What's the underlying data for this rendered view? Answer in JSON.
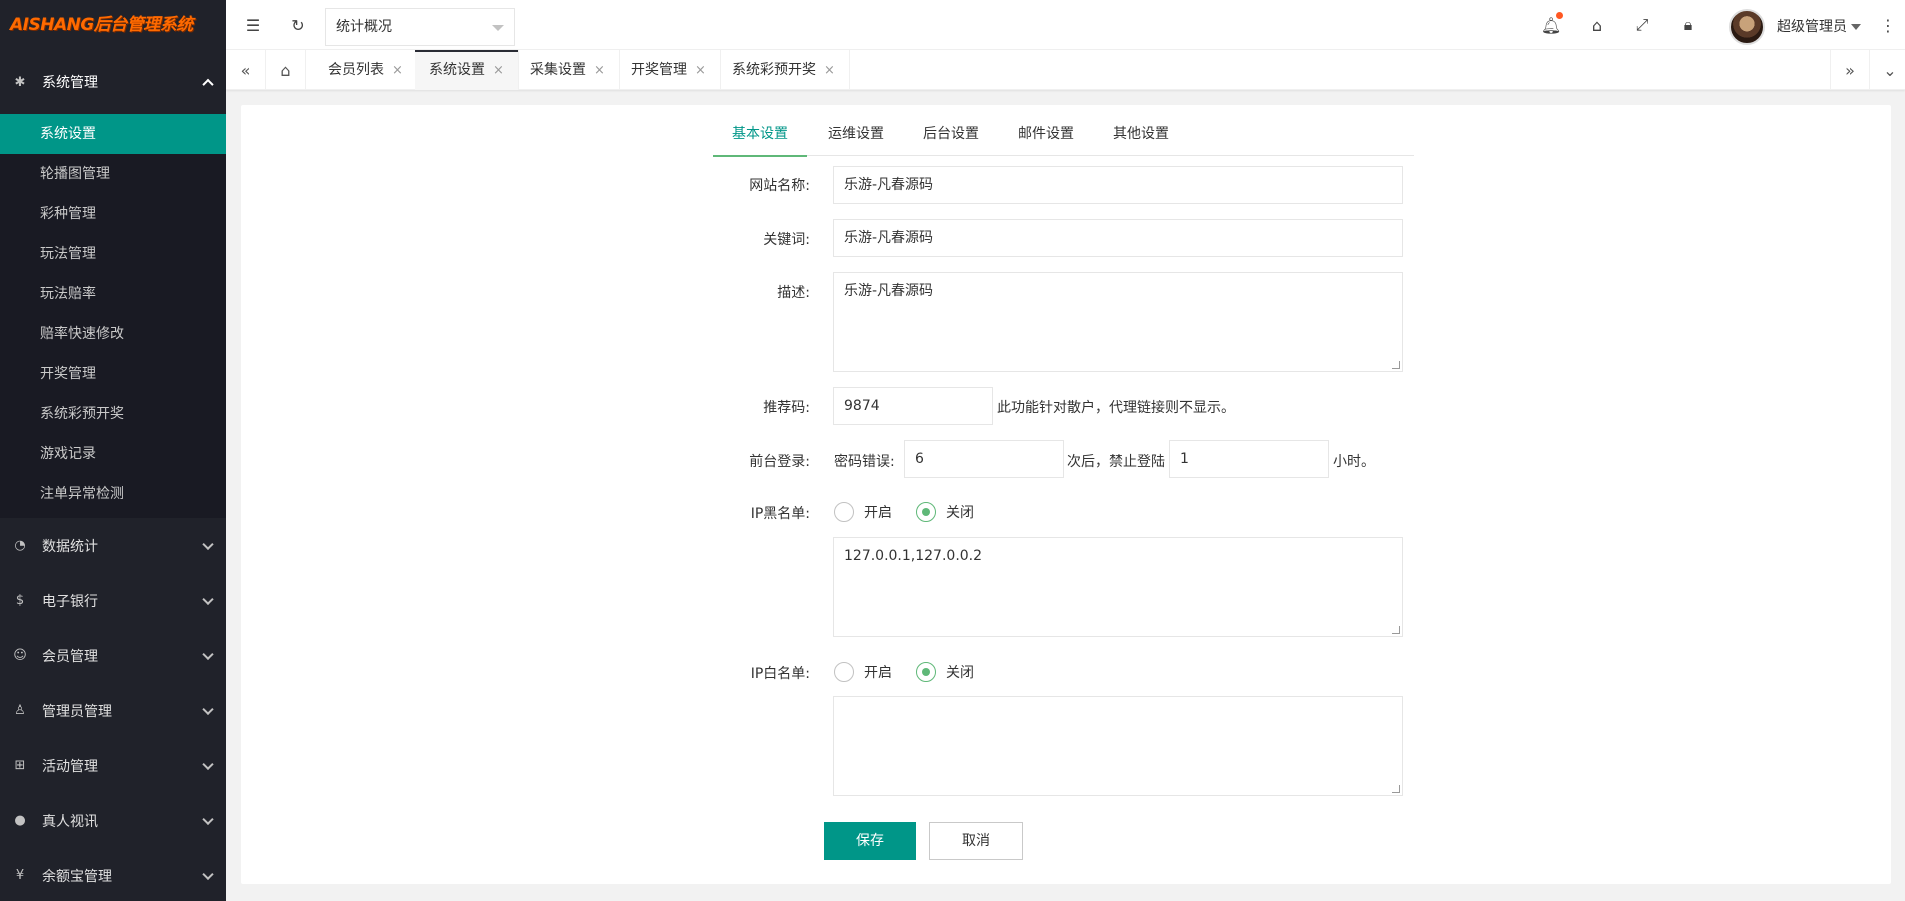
{
  "app": {
    "logo_text": "AISHANG后台管理系统",
    "colors": {
      "accent": "#009688",
      "sidebar_bg": "#20222a",
      "logo": "#ff6a00",
      "radio_on": "#5fb878",
      "badge": "#ff5722"
    }
  },
  "sidebar": {
    "groups": [
      {
        "label": "系统管理",
        "icon": "gear-icon",
        "expanded": true
      },
      {
        "label": "数据统计",
        "icon": "dashboard-icon"
      },
      {
        "label": "电子银行",
        "icon": "dollar-icon"
      },
      {
        "label": "会员管理",
        "icon": "users-icon"
      },
      {
        "label": "管理员管理",
        "icon": "user-icon"
      },
      {
        "label": "活动管理",
        "icon": "gift-icon"
      },
      {
        "label": "真人视讯",
        "icon": "group-icon"
      },
      {
        "label": "余额宝管理",
        "icon": "yen-icon"
      }
    ],
    "subitems": [
      "系统设置",
      "轮播图管理",
      "彩种管理",
      "玩法管理",
      "玩法赔率",
      "赔率快速修改",
      "开奖管理",
      "系统彩预开奖",
      "游戏记录",
      "注单异常检测"
    ],
    "active_subitem": "系统设置"
  },
  "topbar": {
    "select_value": "统计概况",
    "user_name": "超级管理员",
    "icons": [
      "menu-fold-icon",
      "refresh-icon",
      "bell-icon",
      "tag-icon",
      "fullscreen-icon",
      "lock-icon",
      "more-icon"
    ]
  },
  "tabs": {
    "items": [
      {
        "label": "会员列表"
      },
      {
        "label": "系统设置"
      },
      {
        "label": "采集设置"
      },
      {
        "label": "开奖管理"
      },
      {
        "label": "系统彩预开奖"
      }
    ],
    "active": "系统设置",
    "close_glyph": "×"
  },
  "form_tabs": [
    "基本设置",
    "运维设置",
    "后台设置",
    "邮件设置",
    "其他设置"
  ],
  "form": {
    "site_name_label": "网站名称:",
    "site_name_value": "乐游-凡春源码",
    "keywords_label": "关键词:",
    "keywords_value": "乐游-凡春源码",
    "description_label": "描述:",
    "description_value": "乐游-凡春源码",
    "referral_label": "推荐码:",
    "referral_value": "9874",
    "referral_hint": "此功能针对散户，代理链接则不显示。",
    "login_label": "前台登录:",
    "pwd_error_text": "密码错误:",
    "pwd_error_value": "6",
    "times_after_text": "次后，禁止登陆",
    "ban_hours_value": "1",
    "hours_text": "小时。",
    "ip_blacklist_label": "IP黑名单:",
    "ip_blacklist_value": "127.0.0.1,127.0.0.2",
    "ip_whitelist_label": "IP白名单:",
    "ip_whitelist_value": "",
    "radio_on_label": "开启",
    "radio_off_label": "关闭",
    "blacklist_enabled": false,
    "whitelist_enabled": false,
    "save_label": "保存",
    "cancel_label": "取消"
  }
}
